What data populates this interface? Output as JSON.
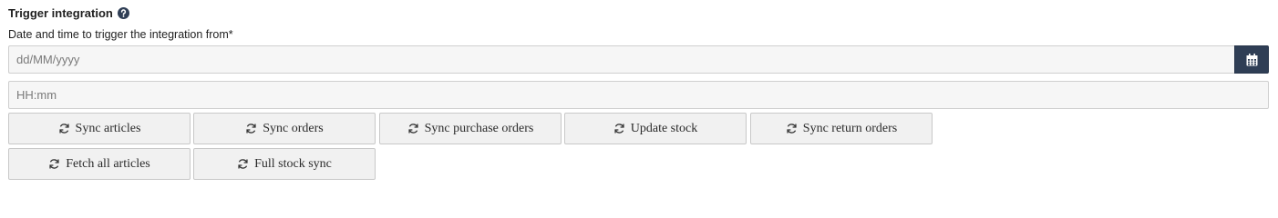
{
  "section": {
    "title": "Trigger integration",
    "help_icon": "question-circle-icon"
  },
  "date_field": {
    "label": "Date and time to trigger the integration from*",
    "date_placeholder": "dd/MM/yyyy",
    "time_placeholder": "HH:mm",
    "calendar_icon": "calendar-icon"
  },
  "colors": {
    "calendar_button": "#2f3e55",
    "input_background": "#f6f6f6",
    "button_background": "#f1f1f1"
  },
  "buttons": [
    {
      "label": "Sync articles",
      "icon": "sync-icon"
    },
    {
      "label": "Sync orders",
      "icon": "sync-icon"
    },
    {
      "label": "Sync purchase orders",
      "icon": "sync-icon"
    },
    {
      "label": "Update stock",
      "icon": "sync-icon"
    },
    {
      "label": "Sync return orders",
      "icon": "sync-icon"
    },
    {
      "label": "Fetch all articles",
      "icon": "sync-icon"
    },
    {
      "label": "Full stock sync",
      "icon": "sync-icon"
    }
  ]
}
